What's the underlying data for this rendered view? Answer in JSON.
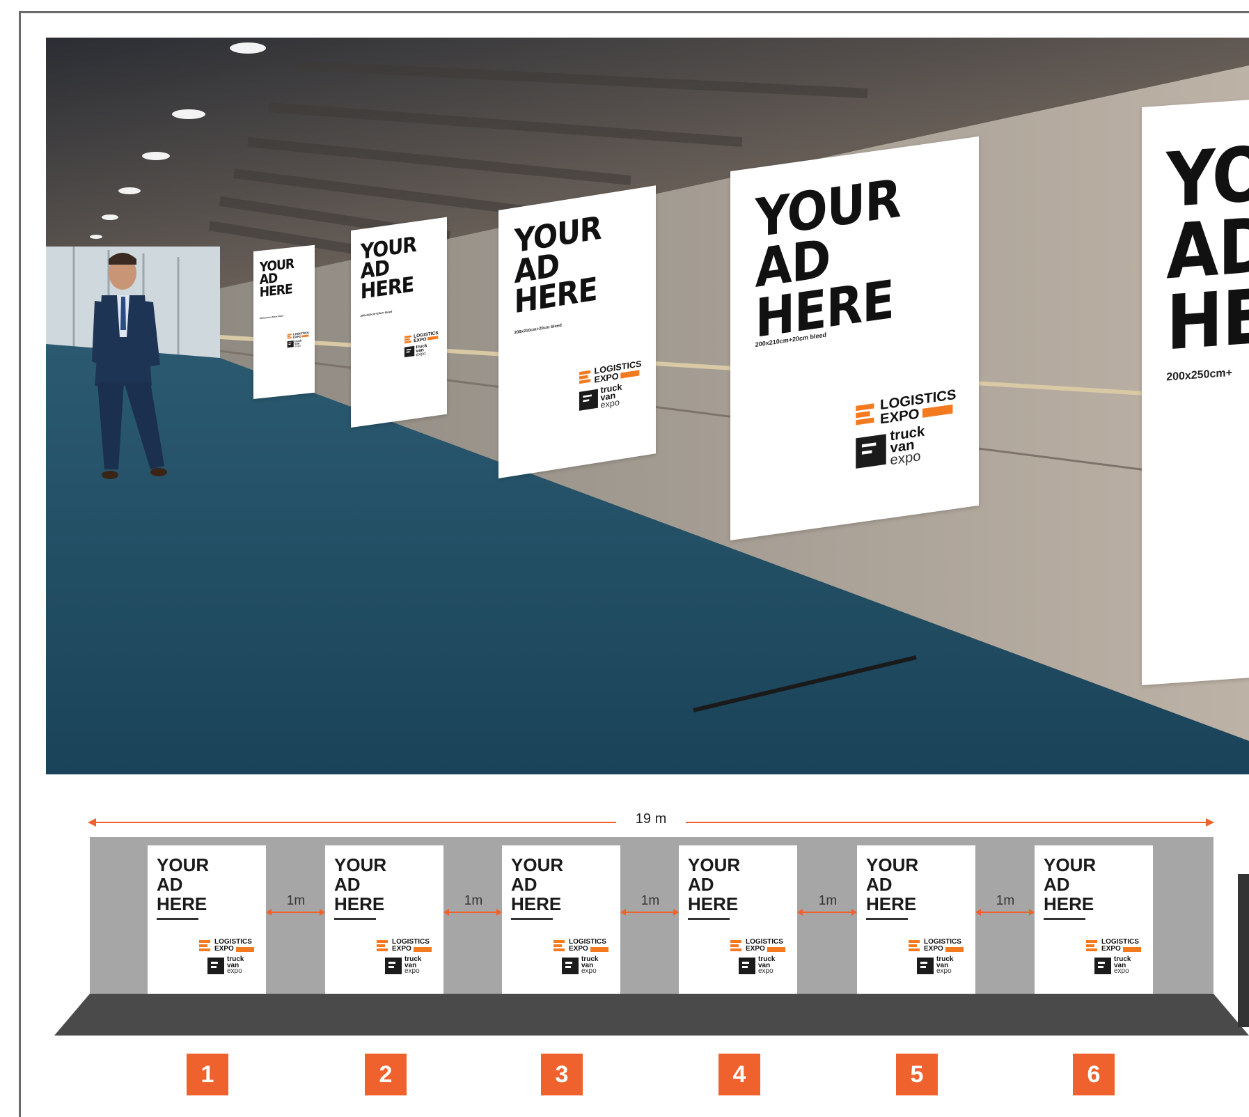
{
  "photo_banners": [
    {
      "line1": "YOUR",
      "line2": "AD",
      "line3": "HERE",
      "size": "200x210cm+20cm bleed"
    },
    {
      "line1": "YOUR",
      "line2": "AD",
      "line3": "HERE",
      "size": "200x210cm+20cm bleed"
    },
    {
      "line1": "YOUR",
      "line2": "AD",
      "line3": "HERE",
      "size": "200x210cm+20cm bleed"
    },
    {
      "line1": "YOUR",
      "line2": "AD",
      "line3": "HERE",
      "size": "200x210cm+20cm bleed"
    },
    {
      "line1": "YO",
      "line2": "AD",
      "line3": "HE",
      "size": "200x250cm+"
    }
  ],
  "logos": {
    "logistics_word": "LOGISTICS",
    "expo_word": "EXPO",
    "truck_word": "truck",
    "van_word": "van",
    "expo_small": "expo"
  },
  "diagram": {
    "total_length": "19 m",
    "gap_label": "1m",
    "panels": [
      {
        "number": "1",
        "line1": "YOUR",
        "line2": "AD",
        "line3": "HERE"
      },
      {
        "number": "2",
        "line1": "YOUR",
        "line2": "AD",
        "line3": "HERE"
      },
      {
        "number": "3",
        "line1": "YOUR",
        "line2": "AD",
        "line3": "HERE"
      },
      {
        "number": "4",
        "line1": "YOUR",
        "line2": "AD",
        "line3": "HERE"
      },
      {
        "number": "5",
        "line1": "YOUR",
        "line2": "AD",
        "line3": "HERE"
      },
      {
        "number": "6",
        "line1": "YOUR",
        "line2": "AD",
        "line3": "HERE"
      }
    ]
  },
  "colors": {
    "accent": "#f0622d",
    "logo_orange": "#f47a20",
    "wall": "#a6a6a6",
    "floor": "#4a4a4a",
    "carpet": "#1f4e66"
  }
}
